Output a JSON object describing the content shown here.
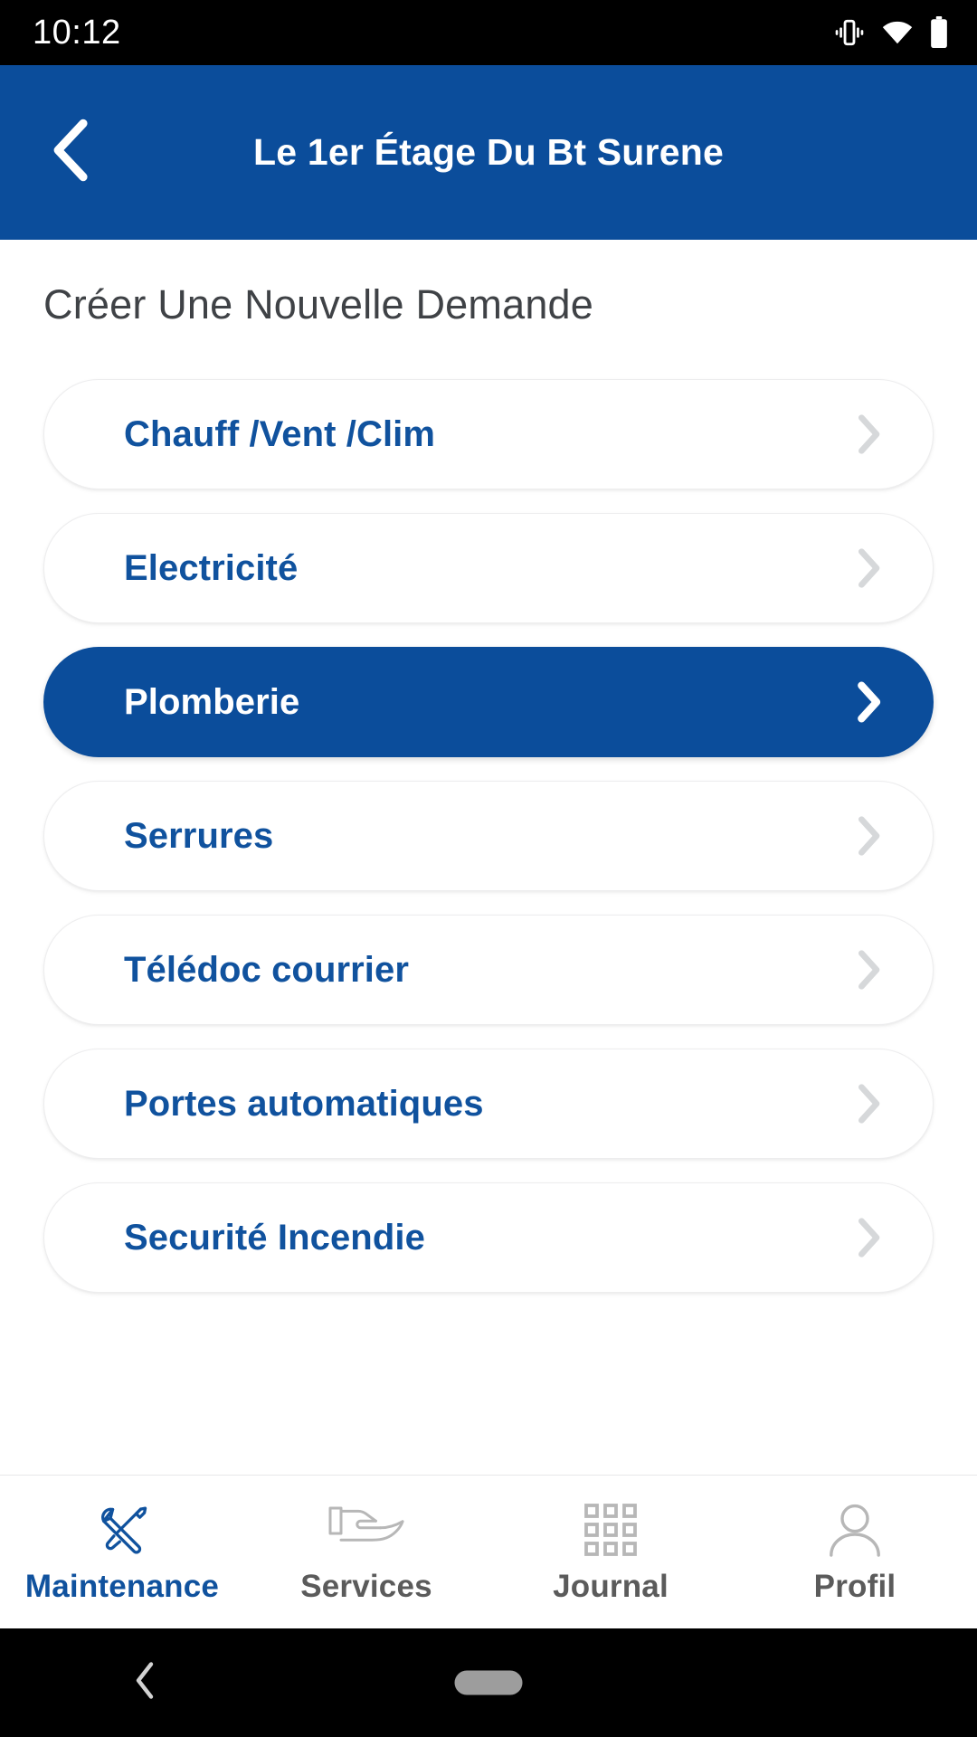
{
  "status_bar": {
    "time": "10:12",
    "icons": [
      "vibrate-icon",
      "wifi-icon",
      "battery-icon"
    ]
  },
  "header": {
    "title": "Le 1er Étage Du Bt Surene",
    "back_icon": "chevron-left-icon"
  },
  "main": {
    "page_title": "Créer Une Nouvelle Demande",
    "items": [
      {
        "label": "Chauff /Vent /Clim",
        "selected": false
      },
      {
        "label": "Electricité",
        "selected": false
      },
      {
        "label": "Plomberie",
        "selected": true
      },
      {
        "label": "Serrures",
        "selected": false
      },
      {
        "label": "Télédoc courrier",
        "selected": false
      },
      {
        "label": "Portes automatiques",
        "selected": false
      },
      {
        "label": "Securité Incendie",
        "selected": false
      }
    ],
    "item_chevron_icon": "chevron-right-icon"
  },
  "tabbar": {
    "tabs": [
      {
        "label": "Maintenance",
        "icon": "tools-icon",
        "active": true
      },
      {
        "label": "Services",
        "icon": "hand-icon",
        "active": false
      },
      {
        "label": "Journal",
        "icon": "grid-icon",
        "active": false
      },
      {
        "label": "Profil",
        "icon": "person-icon",
        "active": false
      }
    ]
  },
  "navigation_bar": {
    "back_icon": "android-back-icon",
    "home_pill": "home-gesture-pill"
  },
  "colors": {
    "brand_blue": "#0B4D9B",
    "link_blue": "#10529E",
    "title_gray": "#3f4246",
    "tab_gray": "#5b5b5b",
    "chevron_gray": "#d6d8da"
  }
}
